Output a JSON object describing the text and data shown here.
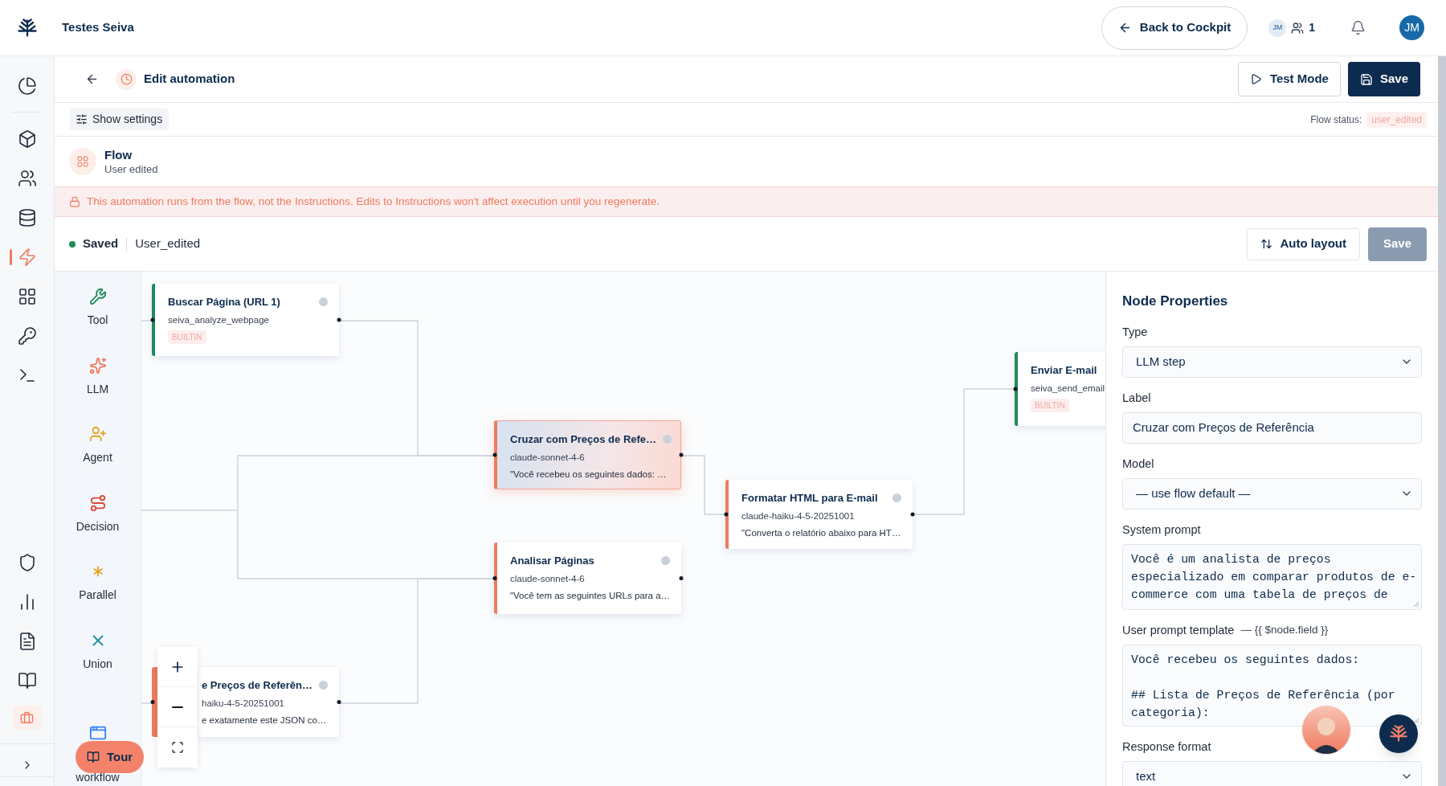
{
  "top_bar": {
    "workspace": "Testes Seiva",
    "back_button": "Back to Cockpit",
    "presence_initials": "JM",
    "presence_count": "1",
    "avatar_initials": "JM"
  },
  "rail": {
    "top_items": [
      {
        "kind": "pie",
        "selected": false
      },
      {
        "kind": "cube",
        "selected": false
      },
      {
        "kind": "users",
        "selected": false
      },
      {
        "kind": "database",
        "selected": false
      },
      {
        "kind": "zap",
        "selected": true
      },
      {
        "kind": "grid",
        "selected": false
      },
      {
        "kind": "key",
        "selected": false
      },
      {
        "kind": "terminal",
        "selected": false
      }
    ],
    "bottom_items": [
      {
        "kind": "shield",
        "selected": false
      },
      {
        "kind": "chart",
        "selected": false
      },
      {
        "kind": "file",
        "selected": false
      },
      {
        "kind": "book",
        "selected": false
      },
      {
        "kind": "briefcase",
        "selected": true
      }
    ]
  },
  "header": {
    "title": "Edit automation",
    "test_button": "Test Mode",
    "save_button": "Save"
  },
  "settings_bar": {
    "show_settings": "Show settings",
    "flow_status_label": "Flow status:",
    "flow_status": "user_edited"
  },
  "flow": {
    "title": "Flow",
    "subtitle": "User edited"
  },
  "banner": "This automation runs from the flow, not the Instructions. Edits to Instructions won't affect execution until you regenerate.",
  "toolbar": {
    "status": "Saved",
    "version": "User_edited",
    "auto_layout": "Auto layout",
    "save_button": {
      "label": "Save",
      "disabled": true
    }
  },
  "palette": [
    {
      "kind": "tool",
      "label": "Tool"
    },
    {
      "kind": "llm",
      "label": "LLM"
    },
    {
      "kind": "agent",
      "label": "Agent"
    },
    {
      "kind": "decision",
      "label": "Decision"
    },
    {
      "kind": "parallel",
      "label": "Parallel"
    },
    {
      "kind": "union",
      "label": "Union"
    },
    {
      "kind": "workflow",
      "label": "workflow"
    }
  ],
  "nodes": [
    {
      "kind": "tool",
      "title": "Buscar Página (URL 1)",
      "subtitle": "seiva_analyze_webpage",
      "badge": "BUILTIN",
      "selected": false,
      "covered": false
    },
    {
      "kind": "llm",
      "title": "Cruzar com Preços de Refe…",
      "subtitle": "claude-sonnet-4-6",
      "preview": "\"Você recebeu os seguintes dados: …",
      "selected": true,
      "covered": false
    },
    {
      "kind": "llm",
      "title": "Analisar Páginas",
      "subtitle": "claude-sonnet-4-6",
      "preview": "\"Você tem as seguintes URLs para a…",
      "selected": false,
      "covered": false
    },
    {
      "kind": "llm",
      "title": "Formatar HTML para E-mail",
      "subtitle": "claude-haiku-4-5-20251001",
      "preview": "\"Converta o relatório abaixo para HT…",
      "selected": false,
      "covered": false
    },
    {
      "kind": "tool",
      "title": "Enviar E-mail",
      "subtitle": "seiva_send_email",
      "badge": "BUILTIN",
      "selected": false,
      "covered": false
    },
    {
      "kind": "llm",
      "title": "e Preços de Referên…",
      "subtitle": "haiku-4-5-20251001",
      "preview": "e exatamente este JSON co…",
      "selected": false,
      "covered": true
    }
  ],
  "tour_button": "Tour",
  "properties": {
    "title": "Node Properties",
    "fields": [
      {
        "kind": "select",
        "label": "Type",
        "value": "LLM step"
      },
      {
        "kind": "input",
        "label": "Label",
        "value": "Cruzar com Preços de Referência"
      },
      {
        "kind": "select",
        "label": "Model",
        "value": "— use flow default —"
      },
      {
        "kind": "textarea",
        "label": "System prompt",
        "value": "Você é um analista de preços especializado em comparar produtos de e-commerce com uma tabela de preços de"
      },
      {
        "kind": "textarea",
        "label": "User prompt template",
        "hint": "— {{ $node.field }}",
        "value": "Você recebeu os seguintes dados:\n\n## Lista de Preços de Referência (por categoria):"
      },
      {
        "kind": "select",
        "label": "Response format",
        "value": "text"
      }
    ]
  }
}
